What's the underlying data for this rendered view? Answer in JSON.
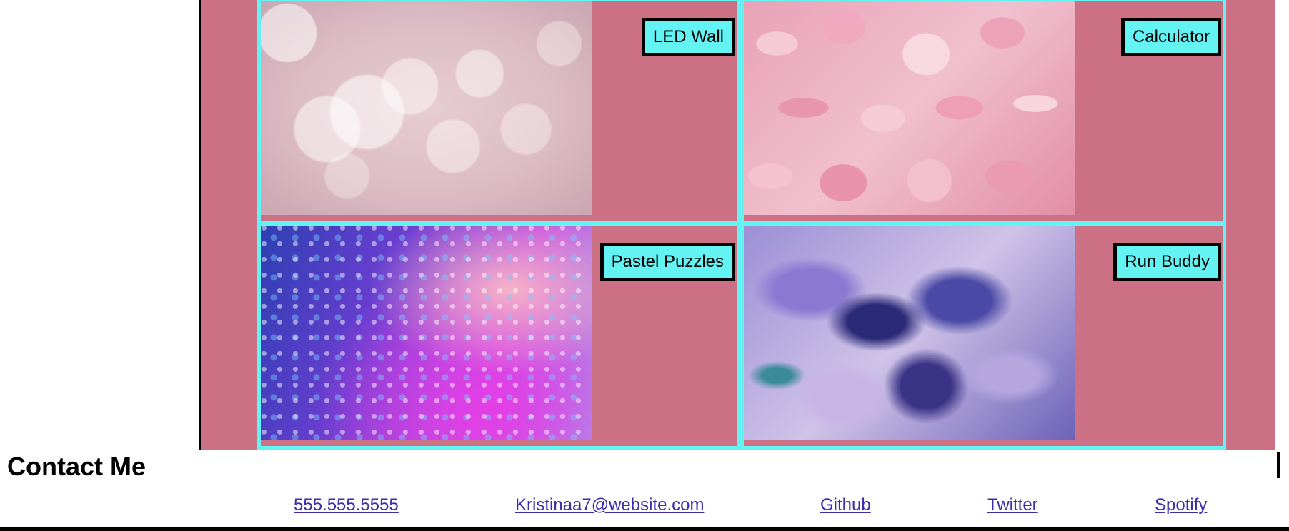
{
  "projects": [
    {
      "title": "LED Wall",
      "image": "bokeh-image"
    },
    {
      "title": "Calculator",
      "image": "rose-petals-image"
    },
    {
      "title": "Pastel Puzzles",
      "image": "water-droplets-image"
    },
    {
      "title": "Run Buddy",
      "image": "ink-swirl-image"
    }
  ],
  "contact": {
    "title": "Contact Me",
    "phone": "555.555.5555",
    "email": "Kristinaa7@website.com",
    "github": "Github",
    "twitter": "Twitter",
    "spotify": "Spotify"
  },
  "colors": {
    "section_background": "#cc7086",
    "cell_border": "#63f3f3",
    "label_background": "#63f3f3",
    "link": "#3b2fae"
  }
}
